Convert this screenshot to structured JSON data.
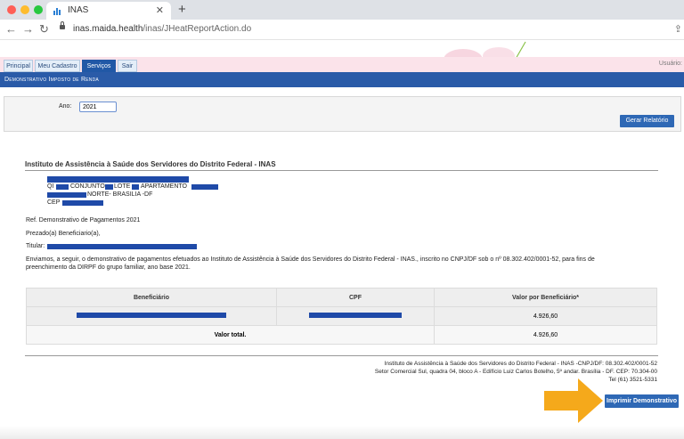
{
  "browser": {
    "tab_title": "INAS",
    "url_domain": "inas.maida.health",
    "url_path": "/inas/JHeatReportAction.do"
  },
  "menu": {
    "tabs": [
      "Principal",
      "Meu Cadastro",
      "Serviços",
      "Sair"
    ],
    "active": "Serviços",
    "usuario_label": "Usuário:"
  },
  "page_title": "Demonstrativo Imposto de Renda",
  "filter": {
    "ano_label": "Ano:",
    "ano_value": "2021",
    "gerar_button": "Gerar Relatório"
  },
  "report": {
    "institution": "Instituto de Assistência à  Saúde dos Servidores do Distrito Federal - INAS",
    "address_qi": "QI",
    "address_conjunto": "CONJUNTO",
    "address_lote": "LOTE",
    "address_apartamento": "APARTAMENTO",
    "address_city": "NORTE- BRASILIA -DF",
    "address_cep": "CEP",
    "ref": "Ref. Demonstrativo de Pagamentos 2021",
    "greeting": "Prezado(a) Beneficiario(a),",
    "titular_label": "Titular:",
    "body_line1": "Enviamos, a seguir, o demonstrativo de pagamentos efetuados ao Instituto de Assistência à  Saúde dos Servidores do Distrito Federal - INAS., inscrito no CNPJ/DF sob o nº 08.302.402/0001-52, para fins de",
    "body_line2": "preenchimento da DIRPF do grupo familiar, ano base 2021.",
    "table": {
      "headers": [
        "Beneficiário",
        "CPF",
        "Valor por Beneficiário*"
      ],
      "rows": [
        {
          "valor": "4.926,60"
        }
      ],
      "total_label": "Valor total.",
      "total_value": "4.926,60"
    },
    "footer_line1": "Instituto de Assistência à  Saúde dos Servidores do Distrito Federal - INAS -CNPJ/DF: 08.302.402/0001-52",
    "footer_line2": "Setor Comercial Sul, quadra 04, bloco A - Edifício Luiz Carlos Botelho, 5º andar. Brasília - DF. CEP: 70.304-00",
    "footer_line3": "Tel (61) 3521-5331",
    "imprimir_button": "Imprimir Demonstrativo"
  },
  "colors": {
    "header_blue": "#2a5ba8",
    "redaction": "#1f4aa8",
    "arrow": "#f5a91b",
    "menubar_pink": "#fbe3ea"
  }
}
